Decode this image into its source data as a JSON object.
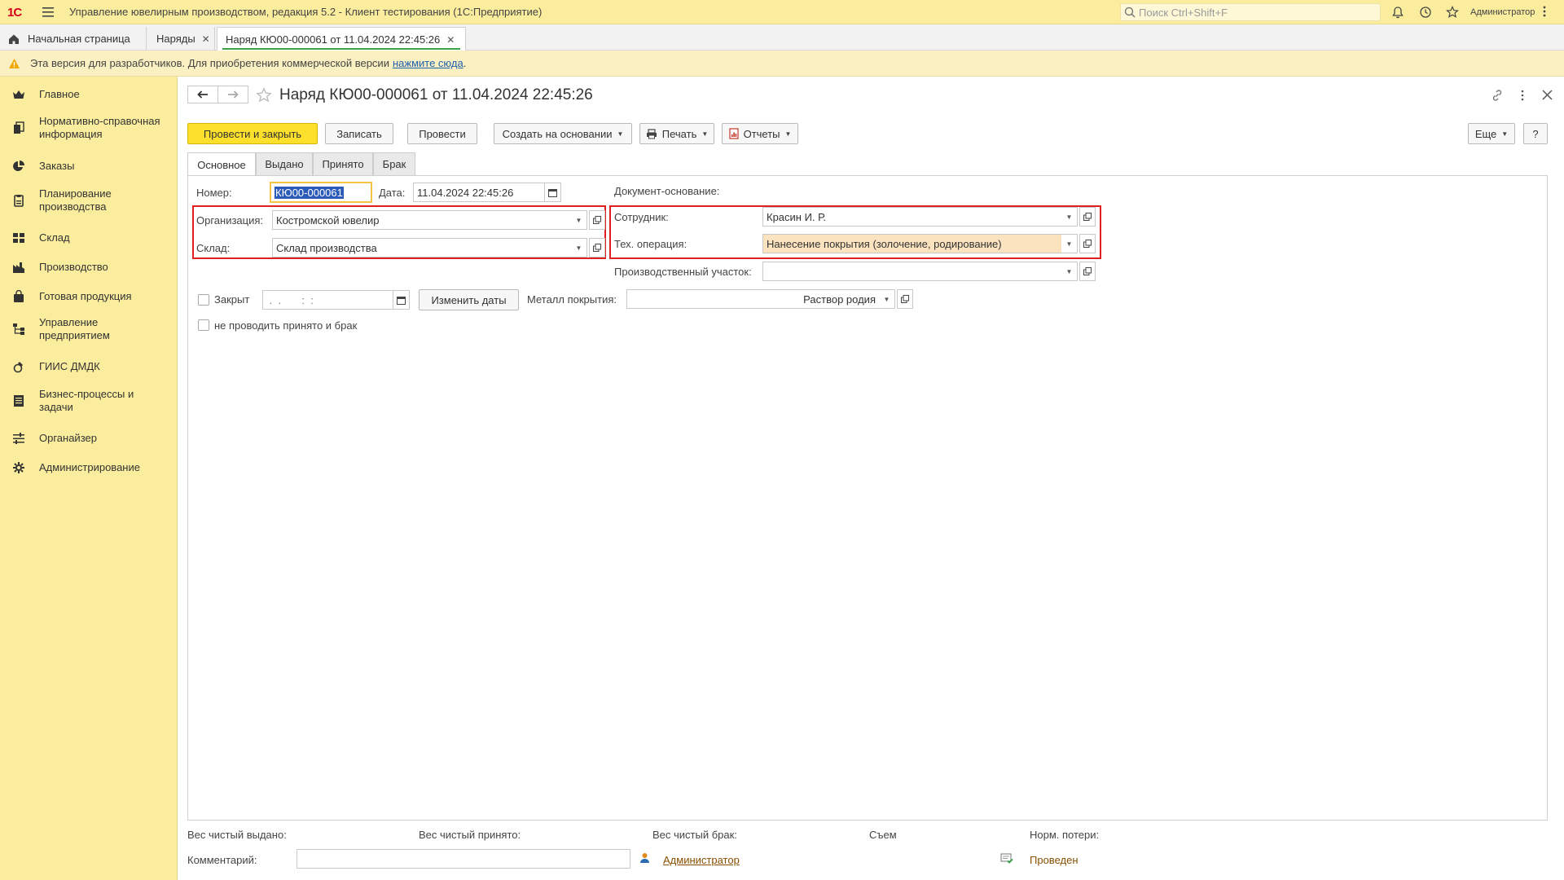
{
  "titlebar": {
    "logo": "1С",
    "app_title": "Управление ювелирным производством, редакция 5.2  - Клиент тестирования (1С:Предприятие)",
    "search_placeholder": "Поиск Ctrl+Shift+F",
    "username": "Администратор"
  },
  "tabs": [
    {
      "label": "Начальная страница"
    },
    {
      "label": "Наряды"
    },
    {
      "label": "Наряд КЮ00-000061 от 11.04.2024 22:45:26"
    }
  ],
  "notice": {
    "text": "Эта версия для разработчиков. Для приобретения коммерческой версии",
    "link": "нажмите сюда",
    "tail": "."
  },
  "sidebar": {
    "items": [
      {
        "label": "Главное"
      },
      {
        "label": "Нормативно-справочная информация"
      },
      {
        "label": "Заказы"
      },
      {
        "label": "Планирование производства"
      },
      {
        "label": "Склад"
      },
      {
        "label": "Производство"
      },
      {
        "label": "Готовая продукция"
      },
      {
        "label": "Управление предприятием"
      },
      {
        "label": "ГИИС ДМДК"
      },
      {
        "label": "Бизнес-процессы и задачи"
      },
      {
        "label": "Органайзер"
      },
      {
        "label": "Администрирование"
      }
    ]
  },
  "document": {
    "title": "Наряд КЮ00-000061 от 11.04.2024 22:45:26"
  },
  "toolbar": {
    "post_close": "Провести и закрыть",
    "save": "Записать",
    "post": "Провести",
    "create_based": "Создать на основании",
    "print": "Печать",
    "reports": "Отчеты",
    "more": "Еще",
    "help": "?"
  },
  "form_tabs": [
    "Основное",
    "Выдано",
    "Принято",
    "Брак"
  ],
  "fields": {
    "number_label": "Номер:",
    "number_value": "КЮ00-000061",
    "date_label": "Дата:",
    "date_value": "11.04.2024 22:45:26",
    "basis_label": "Документ-основание:",
    "org_label": "Организация:",
    "org_value": "Костромской ювелир",
    "warehouse_label": "Склад:",
    "warehouse_value": "Склад производства",
    "employee_label": "Сотрудник:",
    "employee_value": "Красин И. Р.",
    "operation_label": "Тех. операция:",
    "operation_value": "Нанесение покрытия (золочение, родирование)",
    "area_label": "Производственный участок:",
    "area_value": "",
    "closed_label": "Закрыт",
    "closed_date_value": " .  .       :  :",
    "change_dates": "Изменить даты",
    "metal_label": "Металл покрытия:",
    "metal_value": "Раствор родия",
    "skip_label": "не проводить принято и брак"
  },
  "footer": {
    "weight_issued": "Вес чистый выдано:",
    "weight_received": "Вес чистый принято:",
    "weight_defect": "Вес чистый брак:",
    "removal": "Съем",
    "norm_loss": "Норм. потери:",
    "comment_label": "Комментарий:",
    "comment_value": "",
    "author": "Администратор",
    "status": "Проведен"
  },
  "colors": {
    "sidebar_bg": "#fbed9e",
    "primary_button": "#fce02b",
    "highlight_frame": "#e02020",
    "operation_field_bg": "#fbe3c0"
  }
}
